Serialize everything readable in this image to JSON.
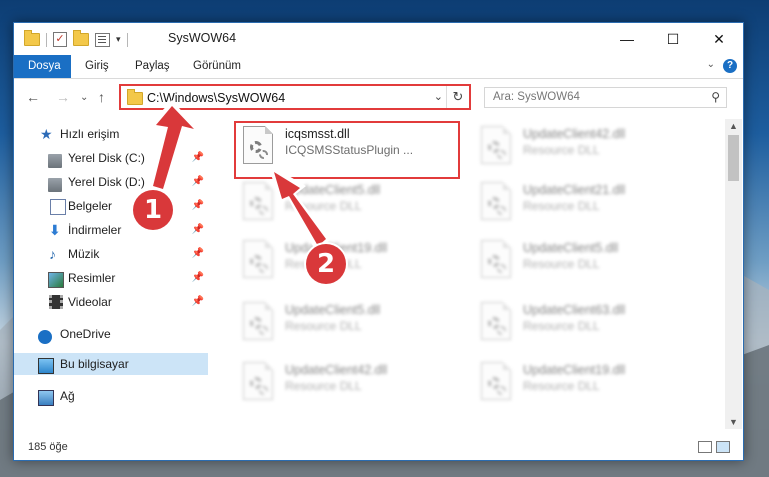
{
  "window": {
    "title": "SysWOW64",
    "controls": {
      "minimize": "—",
      "maximize": "☐",
      "close": "✕"
    }
  },
  "ribbon": {
    "tabs": [
      "Dosya",
      "Giriş",
      "Paylaş",
      "Görünüm"
    ]
  },
  "address": {
    "path": "C:\\Windows\\SysWOW64",
    "search_placeholder": "Ara: SysWOW64"
  },
  "sidebar": {
    "items": [
      {
        "label": "Hızlı erişim",
        "icon": "star-icon"
      },
      {
        "label": "Yerel Disk (C:)",
        "icon": "disk-icon",
        "pinned": true
      },
      {
        "label": "Yerel Disk (D:)",
        "icon": "disk-icon",
        "pinned": true
      },
      {
        "label": "Belgeler",
        "icon": "document-icon",
        "pinned": true
      },
      {
        "label": "İndirmeler",
        "icon": "download-icon",
        "pinned": true
      },
      {
        "label": "Müzik",
        "icon": "music-icon",
        "pinned": true
      },
      {
        "label": "Resimler",
        "icon": "pictures-icon",
        "pinned": true
      },
      {
        "label": "Videolar",
        "icon": "videos-icon",
        "pinned": true
      },
      {
        "label": "OneDrive",
        "icon": "cloud-icon"
      },
      {
        "label": "Bu bilgisayar",
        "icon": "computer-icon",
        "selected": true
      },
      {
        "label": "Ağ",
        "icon": "network-icon"
      }
    ]
  },
  "files": [
    {
      "name": "icqsmsst.dll",
      "desc": "ICQSMSStatusPlugin ..."
    },
    {
      "name": "UpdateClient42.dll",
      "desc": "Resource DLL"
    },
    {
      "name": "UpdateClient5.dll",
      "desc": "Resource DLL"
    },
    {
      "name": "UpdateClient21.dll",
      "desc": "Resource DLL"
    },
    {
      "name": "UpdateClient19.dll",
      "desc": "Resource DLL"
    },
    {
      "name": "UpdateClient5.dll",
      "desc": "Resource DLL"
    },
    {
      "name": "UpdateClient5.dll",
      "desc": "Resource DLL"
    },
    {
      "name": "UpdateClient63.dll",
      "desc": "Resource DLL"
    },
    {
      "name": "UpdateClient42.dll",
      "desc": "Resource DLL"
    },
    {
      "name": "UpdateClient19.dll",
      "desc": "Resource DLL"
    }
  ],
  "status": {
    "count": "185 öğe"
  },
  "callouts": {
    "one": "1",
    "two": "2"
  },
  "colors": {
    "accent": "#1a6fc4",
    "highlight": "#e23b3b",
    "selection": "#cce4f7"
  }
}
